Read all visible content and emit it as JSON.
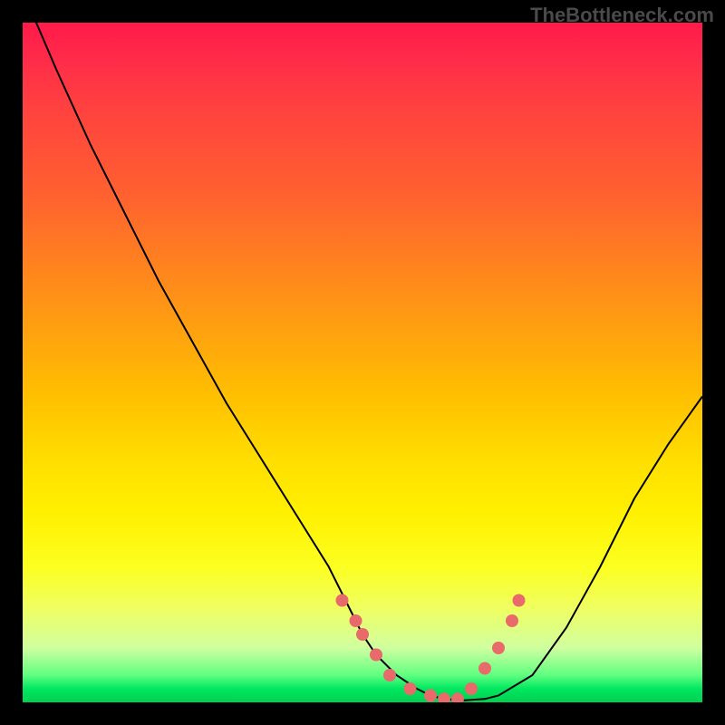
{
  "watermark": "TheBottleneck.com",
  "chart_data": {
    "type": "line",
    "title": "",
    "xlabel": "",
    "ylabel": "",
    "xlim": [
      0,
      100
    ],
    "ylim": [
      0,
      100
    ],
    "series": [
      {
        "name": "curve",
        "x": [
          0,
          2,
          5,
          10,
          15,
          20,
          25,
          30,
          35,
          40,
          45,
          48,
          50,
          52,
          55,
          58,
          60,
          62,
          65,
          68,
          70,
          75,
          80,
          85,
          90,
          95,
          100
        ],
        "y": [
          105,
          100,
          93,
          82,
          72,
          62,
          53,
          44,
          36,
          28,
          20,
          14,
          10,
          7,
          4,
          2,
          1,
          0.5,
          0.3,
          0.5,
          1,
          4,
          11,
          20,
          30,
          38,
          45
        ]
      }
    ],
    "markers": {
      "name": "data-points",
      "color": "#e86a6a",
      "x": [
        47,
        49,
        50,
        52,
        54,
        57,
        60,
        62,
        64,
        66,
        68,
        70,
        72,
        73
      ],
      "y": [
        15,
        12,
        10,
        7,
        4,
        2,
        1,
        0.5,
        0.5,
        2,
        5,
        8,
        12,
        15
      ]
    }
  }
}
